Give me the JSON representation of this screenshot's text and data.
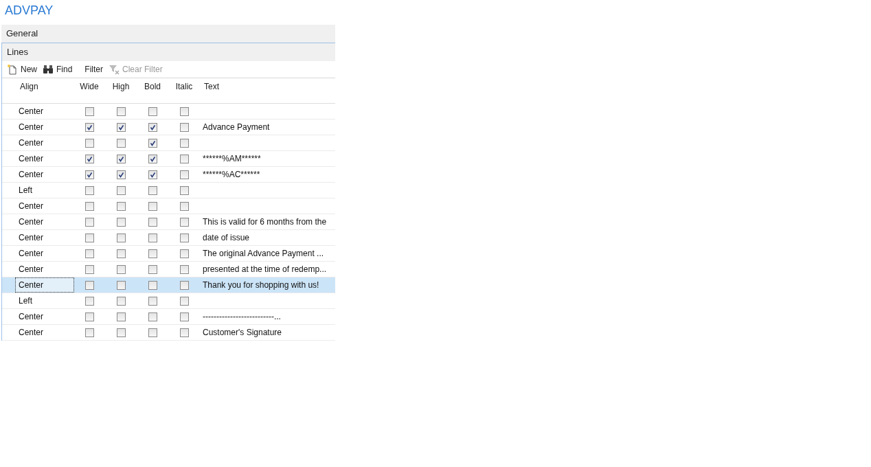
{
  "page_title": "ADVPAY",
  "sections": [
    {
      "label": "General"
    },
    {
      "label": "Lines"
    }
  ],
  "toolbar": [
    {
      "kind": "new",
      "label": "New",
      "disabled": false
    },
    {
      "kind": "find",
      "label": "Find",
      "disabled": false
    },
    {
      "kind": "filter",
      "label": "Filter",
      "disabled": false
    },
    {
      "kind": "clear-filter",
      "label": "Clear Filter",
      "disabled": true
    }
  ],
  "columns": [
    "Align",
    "Wide",
    "High",
    "Bold",
    "Italic",
    "Text"
  ],
  "rows": [
    {
      "align": "Center",
      "wide": false,
      "high": false,
      "bold": false,
      "italic": false,
      "selected": false
    },
    {
      "align": "Center",
      "wide": true,
      "high": true,
      "bold": true,
      "italic": false,
      "text": "Advance Payment",
      "selected": false
    },
    {
      "align": "Center",
      "wide": false,
      "high": false,
      "bold": true,
      "italic": false,
      "selected": false
    },
    {
      "align": "Center",
      "wide": true,
      "high": true,
      "bold": true,
      "italic": false,
      "text": "******%AM******",
      "selected": false
    },
    {
      "align": "Center",
      "wide": true,
      "high": true,
      "bold": true,
      "italic": false,
      "text": "******%AC******",
      "selected": false
    },
    {
      "align": "Left",
      "wide": false,
      "high": false,
      "bold": false,
      "italic": false,
      "selected": false
    },
    {
      "align": "Center",
      "wide": false,
      "high": false,
      "bold": false,
      "italic": false,
      "selected": false
    },
    {
      "align": "Center",
      "wide": false,
      "high": false,
      "bold": false,
      "italic": false,
      "text": "This is valid for 6 months from the",
      "selected": false
    },
    {
      "align": "Center",
      "wide": false,
      "high": false,
      "bold": false,
      "italic": false,
      "text": "date of issue",
      "selected": false
    },
    {
      "align": "Center",
      "wide": false,
      "high": false,
      "bold": false,
      "italic": false,
      "text": "The original Advance Payment ...",
      "selected": false
    },
    {
      "align": "Center",
      "wide": false,
      "high": false,
      "bold": false,
      "italic": false,
      "text": "presented at the time of redemp...",
      "selected": false
    },
    {
      "align": "Center",
      "wide": false,
      "high": false,
      "bold": false,
      "italic": false,
      "text": "Thank you for shopping with us!",
      "selected": true
    },
    {
      "align": "Left",
      "wide": false,
      "high": false,
      "bold": false,
      "italic": false,
      "selected": false
    },
    {
      "align": "Center",
      "wide": false,
      "high": false,
      "bold": false,
      "italic": false,
      "text": "--------------------------...",
      "selected": false
    },
    {
      "align": "Center",
      "wide": false,
      "high": false,
      "bold": false,
      "italic": false,
      "text": "Customer's Signature",
      "selected": false
    }
  ]
}
